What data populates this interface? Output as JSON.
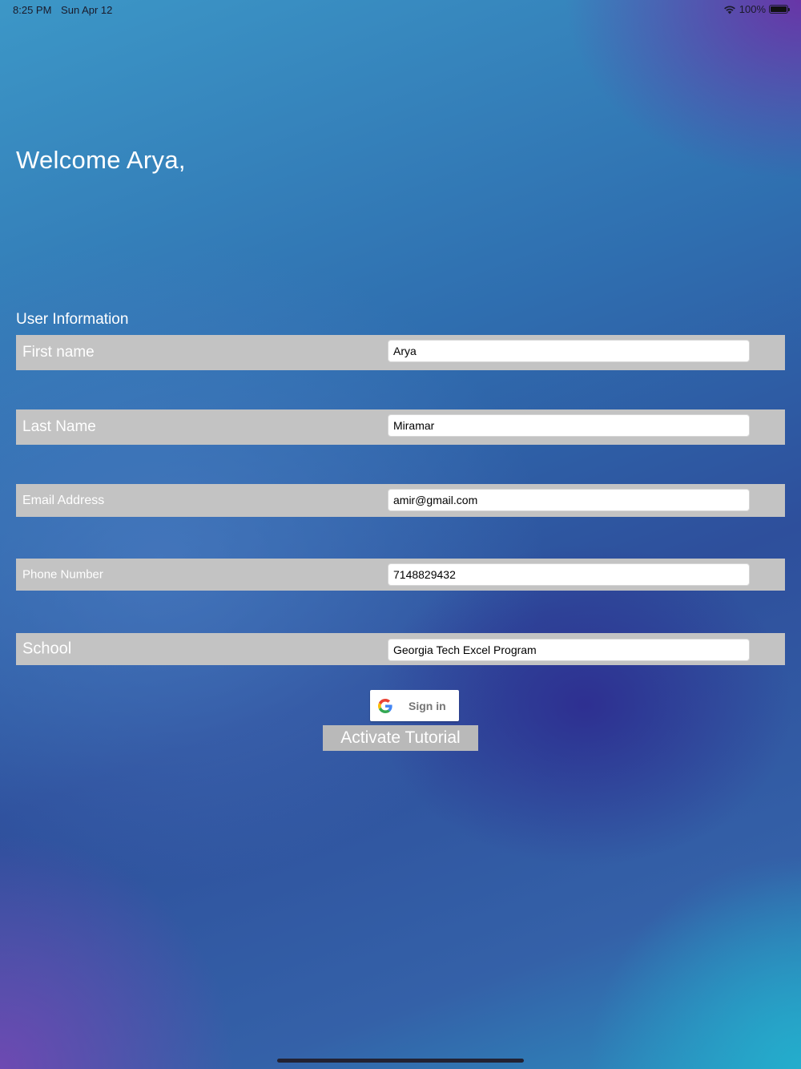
{
  "status_bar": {
    "time": "8:25 PM",
    "date": "Sun Apr 12",
    "battery": "100%"
  },
  "welcome": "Welcome Arya,",
  "section_title": "User Information",
  "fields": {
    "first_name": {
      "label": "First name",
      "value": "Arya"
    },
    "last_name": {
      "label": "Last Name",
      "value": "Miramar"
    },
    "email": {
      "label": "Email Address",
      "value": "amir@gmail.com"
    },
    "phone": {
      "label": "Phone Number",
      "value": "7148829432"
    },
    "school": {
      "label": "School",
      "value": "Georgia Tech Excel Program"
    }
  },
  "google_signin": {
    "label": "Sign in",
    "icon": "google-icon"
  },
  "tutorial_button": "Activate Tutorial",
  "colors": {
    "row_background": "#c3c3c3",
    "button_background": "#b9b9b9",
    "google_label": "#757575"
  }
}
